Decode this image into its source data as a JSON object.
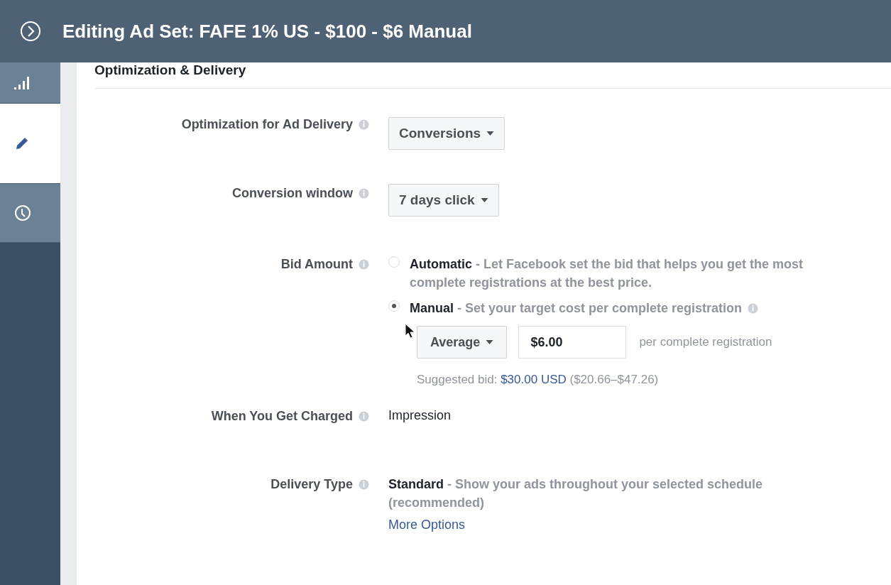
{
  "header": {
    "title": "Editing Ad Set: FAFE 1% US - $100 - $6 Manual"
  },
  "sidebar": {
    "items": [
      {
        "kind": "chart",
        "selected": false
      },
      {
        "kind": "edit",
        "selected": true
      },
      {
        "kind": "history",
        "selected": false
      }
    ]
  },
  "section": {
    "title": "Optimization & Delivery"
  },
  "fields": [
    {
      "kind": "dropdown",
      "label": "Optimization for Ad Delivery",
      "value": "Conversions"
    },
    {
      "kind": "dropdown",
      "label": "Conversion window",
      "value": "7 days click"
    },
    {
      "kind": "bid",
      "label": "Bid Amount",
      "options": [
        {
          "text": "**Automatic** - Let Facebook set the bid that helps you get the most complete registrations at the best price.",
          "selected": false,
          "info": false
        },
        {
          "text": "**Manual** - Set your target cost per complete registration",
          "selected": true,
          "info": true
        }
      ],
      "bid_type": "Average",
      "amount": "$6.00",
      "unit": "per complete registration",
      "suggested_prefix": "Suggested bid:",
      "suggested_link": "$30.00 USD",
      "suggested_range": "($20.66–$47.26)"
    },
    {
      "kind": "text",
      "label": "When You Get Charged",
      "value": "Impression"
    },
    {
      "kind": "delivery",
      "label": "Delivery Type",
      "text": "**Standard** - Show your ads throughout your selected schedule (recommended)",
      "link": "More Options"
    }
  ]
}
